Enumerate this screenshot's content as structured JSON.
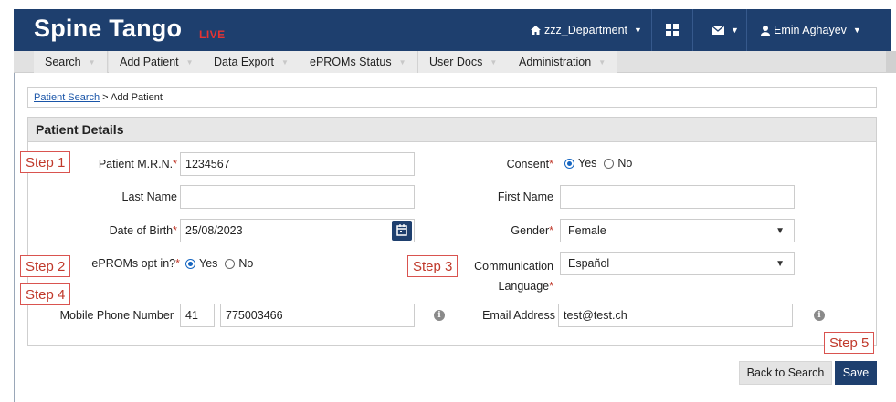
{
  "header": {
    "brand": "Spine Tango",
    "brand_tag": "LIVE",
    "department": "zzz_Department",
    "user": "Emin Aghayev",
    "icons": [
      "home-icon",
      "grid-icon",
      "mail-icon",
      "user-icon"
    ]
  },
  "menu": {
    "items": [
      "Search",
      "Add Patient",
      "Data Export",
      "ePROMs Status",
      "User Docs",
      "Administration"
    ]
  },
  "breadcrumb": {
    "link": "Patient Search",
    "rest": "> Add Patient"
  },
  "panel": {
    "title": "Patient Details"
  },
  "form": {
    "mrn_label": "Patient M.R.N.",
    "mrn_value": "1234567",
    "consent_label": "Consent",
    "consent_yes": "Yes",
    "consent_no": "No",
    "lastname_label": "Last Name",
    "lastname_value": "",
    "firstname_label": "First Name",
    "firstname_value": "",
    "dob_label": "Date of Birth",
    "dob_value": "25/08/2023",
    "gender_label": "Gender",
    "gender_value": "Female",
    "eproms_label": "ePROMs opt in?",
    "eproms_yes": "Yes",
    "eproms_no": "No",
    "comm_label_1": "Communication",
    "comm_label_2": "Language",
    "comm_value": "Español",
    "mobile_label": "Mobile Phone Number",
    "mobile_prefix": "41",
    "mobile_number": "775003466",
    "email_label": "Email Address",
    "email_value": "test@test.ch",
    "required_mark": "*"
  },
  "steps": {
    "s1": "Step 1",
    "s2": "Step 2",
    "s3": "Step 3",
    "s4": "Step 4",
    "s5": "Step 5"
  },
  "buttons": {
    "back": "Back to Search",
    "save": "Save"
  },
  "colors": {
    "primary": "#1e3f6e",
    "live": "#e53333",
    "step_border": "#d9534f"
  }
}
